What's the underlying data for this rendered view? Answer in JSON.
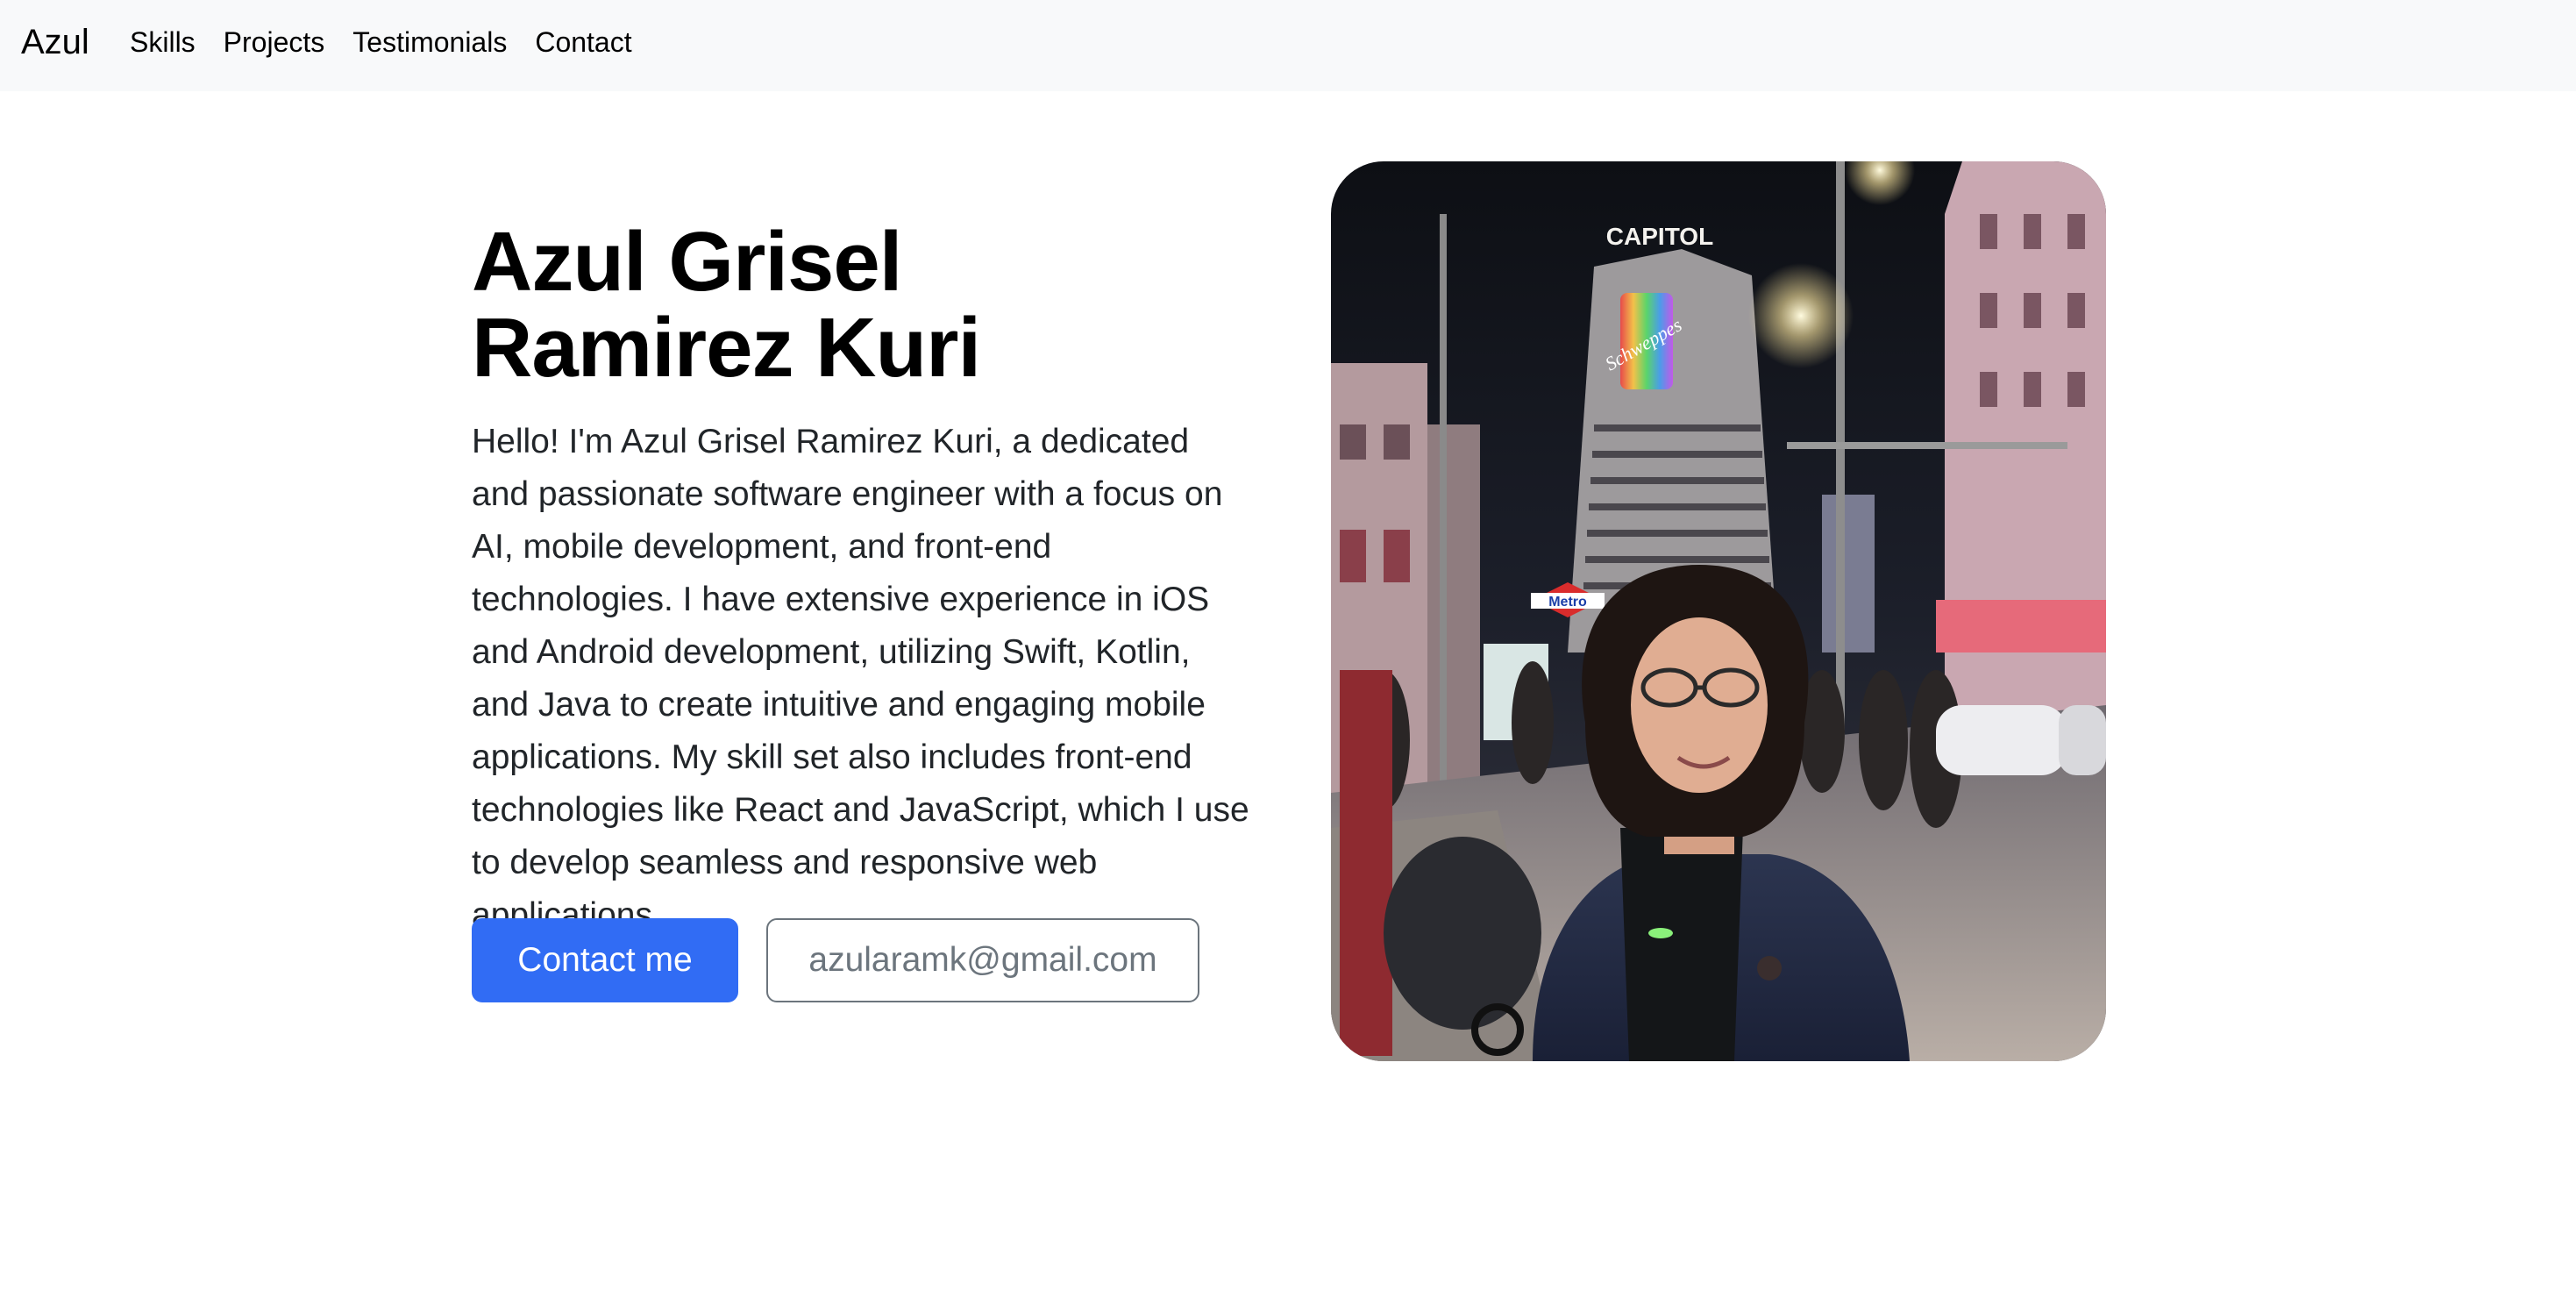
{
  "navbar": {
    "brand": "Azul",
    "links": [
      "Skills",
      "Projects",
      "Testimonials",
      "Contact"
    ]
  },
  "hero": {
    "title_line1": "Azul Grisel",
    "title_line2": "Ramirez Kuri",
    "intro": "Hello! I'm Azul Grisel Ramirez Kuri, a dedicated and passionate software engineer with a focus on AI, mobile development, and front-end technologies. I have extensive experience in iOS and Android development, utilizing Swift, Kotlin, and Java to create intuitive and engaging mobile applications. My skill set also includes front-end technologies like React and JavaScript, which I use to develop seamless and responsive web applications.",
    "contact_button": "Contact me",
    "email_button": "azularamk@gmail.com"
  },
  "photo": {
    "sign_capitol": "CAPITOL",
    "sign_metro": "Metro",
    "sign_schweppes": "Schweppes"
  },
  "colors": {
    "navbar_bg": "#f8f9fa",
    "primary": "#316cf4",
    "outline": "#6c757d"
  }
}
